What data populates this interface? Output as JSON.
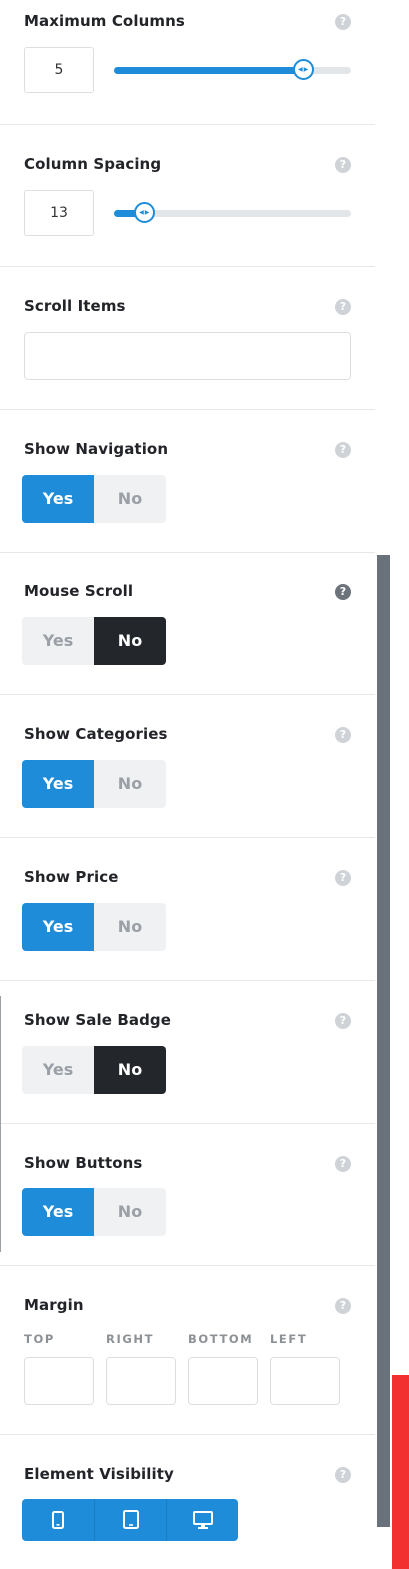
{
  "options": {
    "max_columns": {
      "label": "Maximum Columns",
      "value": "5",
      "slider_fraction": 0.8
    },
    "column_spacing": {
      "label": "Column Spacing",
      "value": "13",
      "slider_fraction": 0.13
    },
    "scroll_items": {
      "label": "Scroll Items",
      "value": ""
    },
    "show_navigation": {
      "label": "Show Navigation",
      "yes": "Yes",
      "no": "No",
      "selected": "Yes"
    },
    "mouse_scroll": {
      "label": "Mouse Scroll",
      "yes": "Yes",
      "no": "No",
      "selected": "No"
    },
    "show_categories": {
      "label": "Show Categories",
      "yes": "Yes",
      "no": "No",
      "selected": "Yes"
    },
    "show_price": {
      "label": "Show Price",
      "yes": "Yes",
      "no": "No",
      "selected": "Yes"
    },
    "show_sale_badge": {
      "label": "Show Sale Badge",
      "yes": "Yes",
      "no": "No",
      "selected": "No"
    },
    "show_buttons": {
      "label": "Show Buttons",
      "yes": "Yes",
      "no": "No",
      "selected": "Yes"
    },
    "margin": {
      "label": "Margin",
      "sides": [
        "TOP",
        "RIGHT",
        "BOTTOM",
        "LEFT"
      ],
      "values": [
        "",
        "",
        "",
        ""
      ]
    },
    "element_visibility": {
      "label": "Element Visibility",
      "devices": [
        "phone-icon",
        "tablet-icon",
        "desktop-icon"
      ]
    }
  },
  "help_glyph": "?",
  "colors": {
    "accent": "#1e8cd8",
    "dark": "#23272c",
    "scrollbar": "#69727b",
    "red_bar": "#f2302f"
  }
}
